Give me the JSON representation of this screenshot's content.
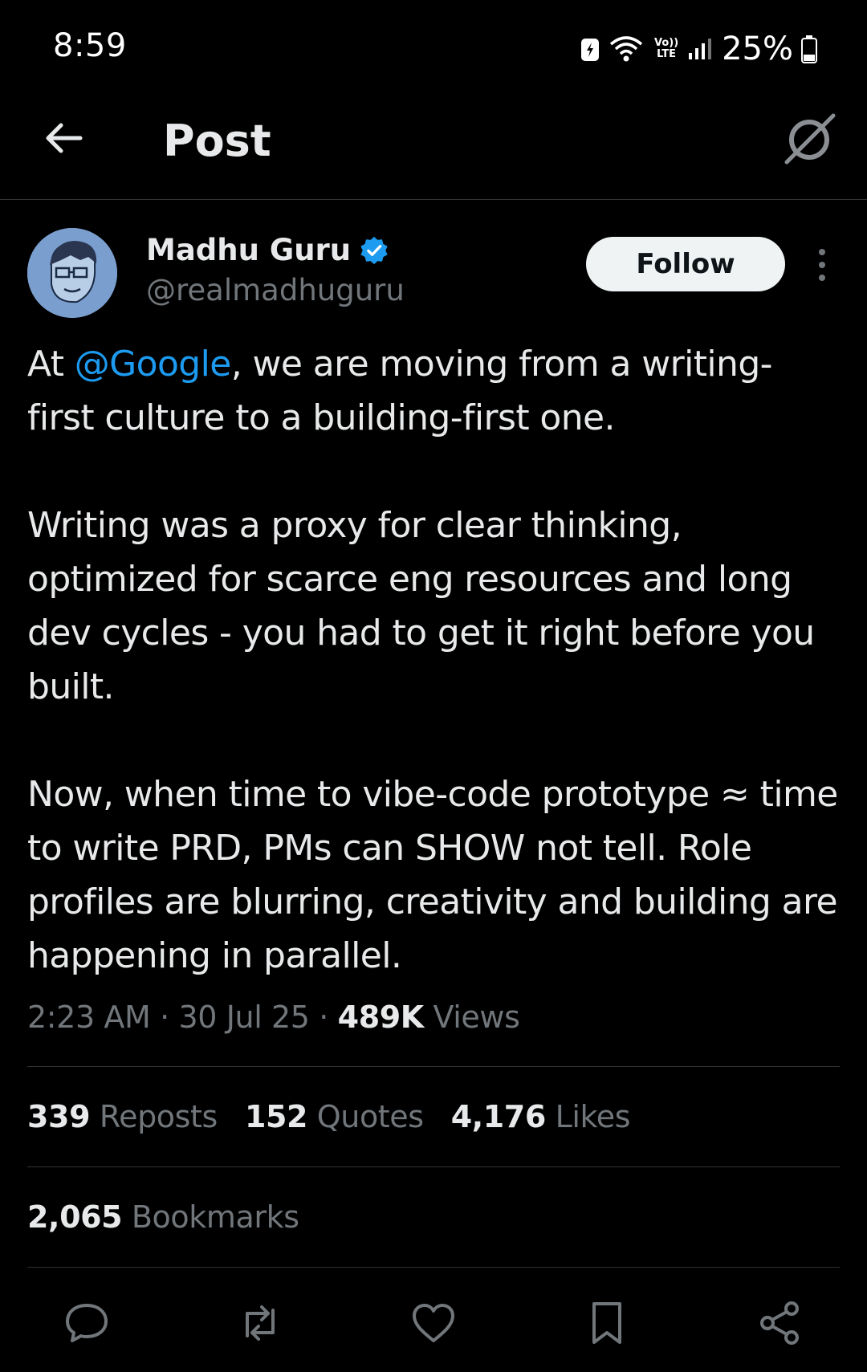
{
  "status_bar": {
    "time": "8:59",
    "battery": "25%",
    "network_label": "Vo)) LTE"
  },
  "nav": {
    "title": "Post",
    "back_icon": "arrow-left-icon",
    "right_icon": "grok-icon"
  },
  "author": {
    "name": "Madhu Guru",
    "handle": "@realmadhuguru",
    "verified": true,
    "follow_label": "Follow"
  },
  "post": {
    "p1_prefix": "At ",
    "p1_mention": "@Google",
    "p1_suffix": ", we are moving from a writing-first culture to a building-first one.",
    "p2": "Writing was a proxy for clear thinking, optimized for scarce eng resources and long dev cycles - you had to get it right before you built.",
    "p3": "Now, when time to vibe-code prototype ≈ time to write PRD, PMs can SHOW not tell. Role profiles are blurring, creativity and building are happening in parallel."
  },
  "meta": {
    "time": "2:23 AM",
    "date": "30 Jul 25",
    "views_count": "489K",
    "views_label": "Views",
    "separator": "·"
  },
  "stats": {
    "reposts_count": "339",
    "reposts_label": "Reposts",
    "quotes_count": "152",
    "quotes_label": "Quotes",
    "likes_count": "4,176",
    "likes_label": "Likes",
    "bookmarks_count": "2,065",
    "bookmarks_label": "Bookmarks"
  },
  "actions": [
    "reply-icon",
    "repost-icon",
    "like-icon",
    "bookmark-icon",
    "share-icon"
  ],
  "colors": {
    "background": "#000000",
    "text": "#e7e9ea",
    "muted": "#71767b",
    "accent": "#1d9bf0",
    "divider": "#2f3336"
  }
}
